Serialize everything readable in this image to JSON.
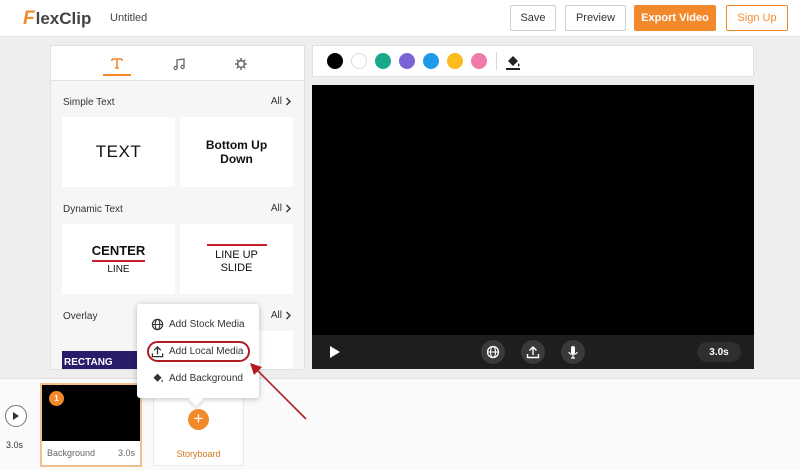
{
  "header": {
    "logo_text": "lexClip",
    "logo_initial": "F",
    "project_title": "Untitled",
    "save_label": "Save",
    "preview_label": "Preview",
    "export_label": "Export Video",
    "signup_label": "Sign Up"
  },
  "left_panel": {
    "tabs": [
      {
        "icon": "text-icon",
        "active": true
      },
      {
        "icon": "music-icon",
        "active": false
      },
      {
        "icon": "gear-icon",
        "active": false
      }
    ],
    "sections": [
      {
        "title": "Simple Text",
        "all_label": "All"
      },
      {
        "title": "Dynamic Text",
        "all_label": "All"
      },
      {
        "title": "Overlay",
        "all_label": "All"
      }
    ],
    "cards": {
      "text": "TEXT",
      "bottom_up": "Bottom Up Down",
      "center": "CENTER",
      "center_sub": "LINE",
      "line_up": "LINE UP SLIDE",
      "overlay_preview": "RECTANG"
    }
  },
  "color_bar": {
    "swatches": [
      "#000000",
      "#ffffff",
      "#1aaa8a",
      "#7b63d6",
      "#1e9be8",
      "#fbbd1d",
      "#f07aa8"
    ],
    "fill_icon": "paint-bucket-icon"
  },
  "player": {
    "duration": "3.0s",
    "icons": [
      "play-icon",
      "globe-icon",
      "upload-icon",
      "microphone-icon"
    ]
  },
  "timeline": {
    "total_time": "3.0s",
    "clip": {
      "number": "1",
      "label": "Background",
      "duration": "3.0s"
    },
    "storyboard_label": "Storyboard"
  },
  "popup_menu": {
    "items": [
      {
        "label": "Add Stock Media",
        "icon": "globe-icon"
      },
      {
        "label": "Add Local Media",
        "icon": "upload-icon",
        "highlighted": true
      },
      {
        "label": "Add Background",
        "icon": "paint-bucket-icon"
      }
    ]
  },
  "colors": {
    "accent": "#f28a2c",
    "highlight": "#b01e24"
  }
}
